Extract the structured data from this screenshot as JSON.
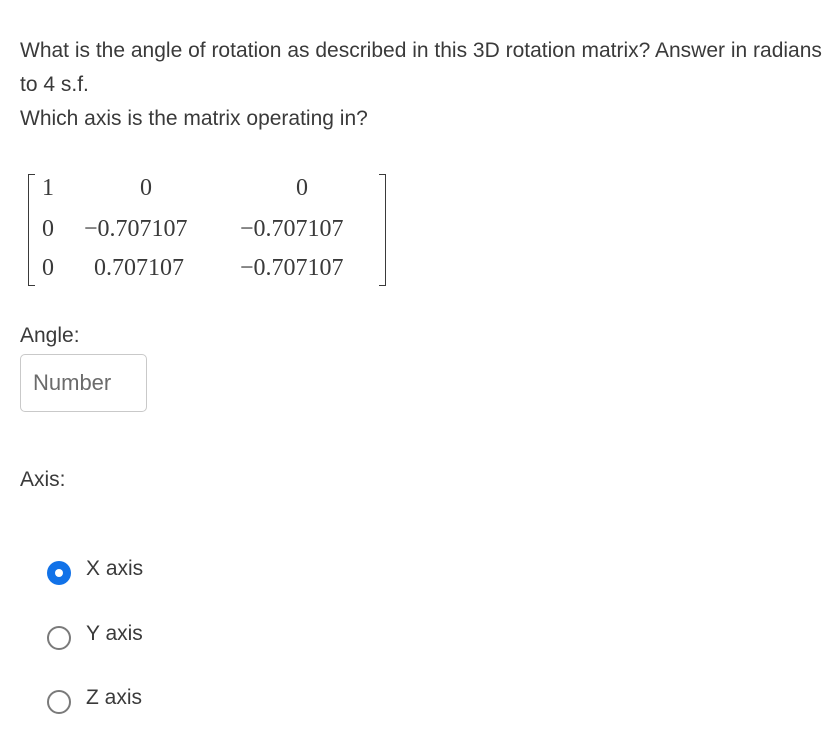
{
  "question": {
    "line1": "What is the angle of rotation as described in this 3D rotation matrix? Answer in radians to 4 s.f.",
    "line2": "Which axis is the matrix operating in?"
  },
  "matrix": {
    "rows": [
      [
        "1",
        "0",
        "0"
      ],
      [
        "0",
        "−0.707107",
        "−0.707107"
      ],
      [
        "0",
        "0.707107",
        "−0.707107"
      ]
    ]
  },
  "angle": {
    "label": "Angle:",
    "placeholder": "Number",
    "value": ""
  },
  "axis": {
    "label": "Axis:",
    "options": [
      {
        "label": "X axis",
        "selected": true
      },
      {
        "label": "Y axis",
        "selected": false
      },
      {
        "label": "Z axis",
        "selected": false
      }
    ]
  },
  "colors": {
    "text": "#3a3a3a",
    "radio_selected": "#1172e8",
    "radio_border": "#7a7a7a",
    "input_border": "#c9c9c9"
  }
}
